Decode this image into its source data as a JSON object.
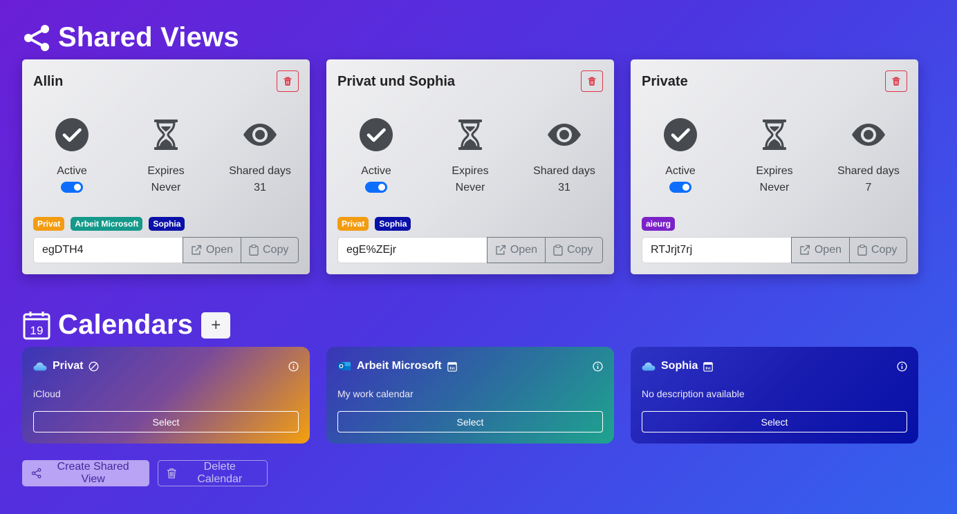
{
  "shared_views": {
    "title": "Shared Views",
    "cards": [
      {
        "name": "Allin",
        "active_label": "Active",
        "expires_label": "Expires",
        "expires_value": "Never",
        "shared_days_label": "Shared days",
        "shared_days_value": "31",
        "badges": [
          {
            "text": "Privat",
            "color": "#f39c12"
          },
          {
            "text": "Arbeit Microsoft",
            "color": "#14998a"
          },
          {
            "text": "Sophia",
            "color": "#0a10a8"
          }
        ],
        "link_code": "egDTH4",
        "open_label": "Open",
        "copy_label": "Copy"
      },
      {
        "name": "Privat und Sophia",
        "active_label": "Active",
        "expires_label": "Expires",
        "expires_value": "Never",
        "shared_days_label": "Shared days",
        "shared_days_value": "31",
        "badges": [
          {
            "text": "Privat",
            "color": "#f39c12"
          },
          {
            "text": "Sophia",
            "color": "#0a10a8"
          }
        ],
        "link_code": "egE%ZEjr",
        "open_label": "Open",
        "copy_label": "Copy"
      },
      {
        "name": "Private",
        "active_label": "Active",
        "expires_label": "Expires",
        "expires_value": "Never",
        "shared_days_label": "Shared days",
        "shared_days_value": "7",
        "badges": [
          {
            "text": "aieurg",
            "color": "#7a22c8"
          }
        ],
        "link_code": "RTJrjt7rj",
        "open_label": "Open",
        "copy_label": "Copy"
      }
    ]
  },
  "calendars": {
    "title": "Calendars",
    "add_label": "+",
    "cards": [
      {
        "name": "Privat",
        "provider_icon": "icloud-icon",
        "status_icon": "disabled-circle-icon",
        "description": "iCloud",
        "select_label": "Select",
        "gradient": [
          "#3a35b8",
          "#7a4a9a",
          "#f5a00e"
        ]
      },
      {
        "name": "Arbeit Microsoft",
        "provider_icon": "outlook-icon",
        "status_icon": "calendar-icon",
        "description": "My work calendar",
        "select_label": "Select",
        "gradient": [
          "#3a35b8",
          "#2c6aa0",
          "#1ea48e"
        ]
      },
      {
        "name": "Sophia",
        "provider_icon": "icloud-icon",
        "status_icon": "calendar-icon",
        "description": "No description available",
        "select_label": "Select",
        "gradient": [
          "#2e33c4",
          "#1a1cb0",
          "#0610a6"
        ]
      }
    ]
  },
  "actions": {
    "create_label": "Create Shared View",
    "delete_label": "Delete Calendar"
  },
  "colors": {
    "toggle_on": "#0d6efd",
    "danger": "#dc3545",
    "icon_dark": "#474a4f"
  }
}
